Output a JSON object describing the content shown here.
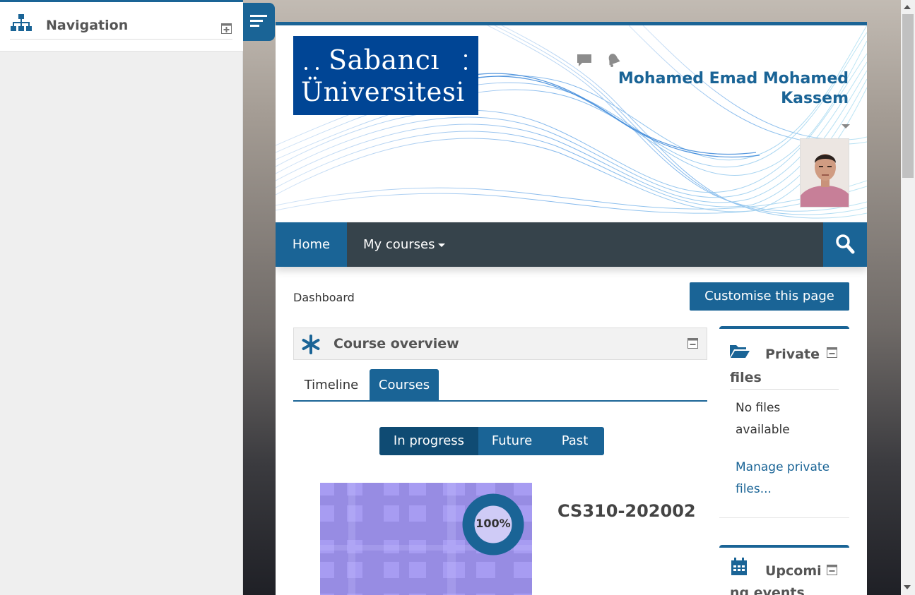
{
  "drawer": {
    "title": "Navigation"
  },
  "header": {
    "logo_line1": "Sabancı",
    "logo_line2": "Üniversitesi",
    "user_name": "Mohamed Emad Mohamed Kassem"
  },
  "navbar": {
    "home": "Home",
    "my_courses": "My courses"
  },
  "page": {
    "breadcrumb": "Dashboard",
    "customise_button": "Customise this page"
  },
  "course_overview": {
    "title": "Course overview",
    "tabs": [
      {
        "label": "Timeline",
        "active": false
      },
      {
        "label": "Courses",
        "active": true
      }
    ],
    "filters": [
      {
        "label": "In progress",
        "active": true
      },
      {
        "label": "Future",
        "active": false
      },
      {
        "label": "Past",
        "active": false
      }
    ],
    "courses": [
      {
        "name": "CS310-202002",
        "progress_label": "100%",
        "progress": 1.0
      }
    ]
  },
  "private_files": {
    "title": "Private files",
    "empty_text": "No files available",
    "manage_link": "Manage private files..."
  },
  "upcoming_events": {
    "title": "Upcoming events"
  },
  "colors": {
    "brand": "#1a6496",
    "navbar": "#36434b",
    "logo_bg": "#004595"
  }
}
